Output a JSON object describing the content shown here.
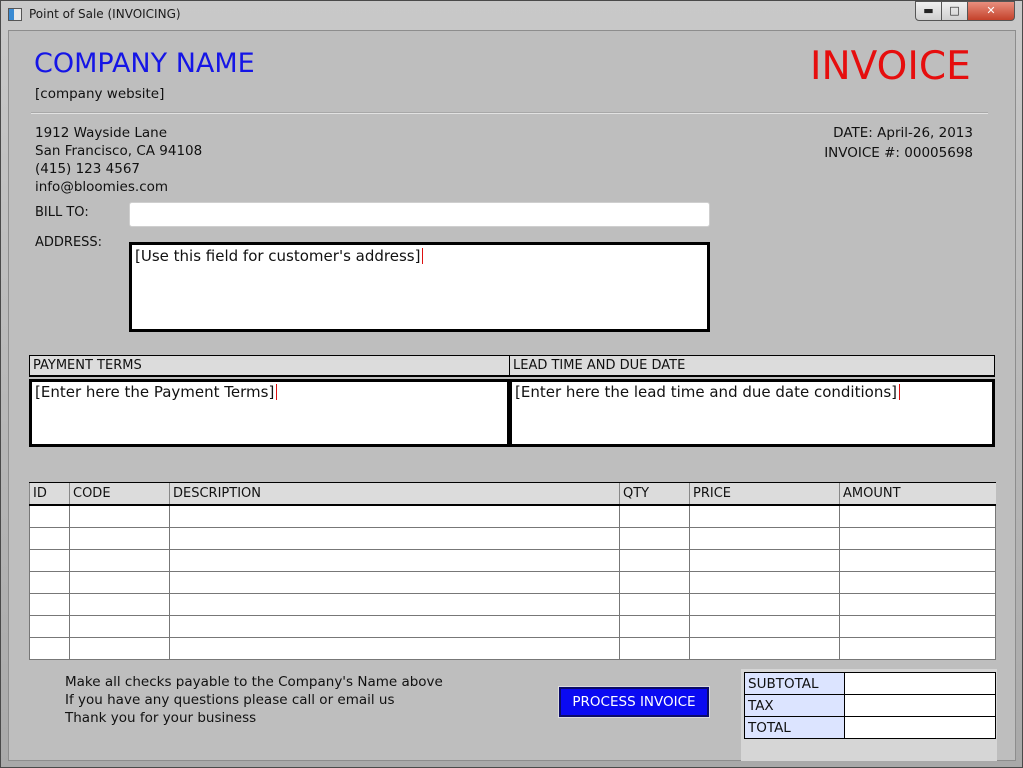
{
  "window": {
    "title": "Point of Sale (INVOICING)",
    "minimize": "▬",
    "maximize": "□",
    "close": "✕"
  },
  "header": {
    "company_name": "COMPANY NAME",
    "website": "[company website]",
    "invoice_title": "INVOICE",
    "address_lines": [
      "1912 Wayside Lane",
      "San Francisco, CA 94108",
      "(415) 123 4567",
      "info@bloomies.com"
    ],
    "date_label": "DATE:",
    "date_value": "April-26, 2013",
    "invoice_no_label": "INVOICE #:",
    "invoice_no_value": "00005698"
  },
  "billing": {
    "bill_to_label": "BILL TO:",
    "bill_to_value": "",
    "address_label": "ADDRESS:",
    "address_value": "[Use this field for customer's address]"
  },
  "terms": {
    "payment_terms_header": "PAYMENT TERMS",
    "payment_terms_value": "[Enter here the Payment Terms]",
    "lead_time_header": "LEAD TIME AND DUE DATE",
    "lead_time_value": "[Enter here the lead time and due date conditions]"
  },
  "items": {
    "columns": [
      "ID",
      "CODE",
      "DESCRIPTION",
      "QTY",
      "PRICE",
      "AMOUNT"
    ],
    "rows": [
      [
        "",
        "",
        "",
        "",
        "",
        ""
      ],
      [
        "",
        "",
        "",
        "",
        "",
        ""
      ],
      [
        "",
        "",
        "",
        "",
        "",
        ""
      ],
      [
        "",
        "",
        "",
        "",
        "",
        ""
      ],
      [
        "",
        "",
        "",
        "",
        "",
        ""
      ],
      [
        "",
        "",
        "",
        "",
        "",
        ""
      ],
      [
        "",
        "",
        "",
        "",
        "",
        ""
      ]
    ]
  },
  "footer": {
    "notes": [
      "Make all checks payable to the Company's Name above",
      "If you have any questions please call or email us",
      "Thank you for your business"
    ],
    "process_button": "PROCESS INVOICE",
    "subtotal_label": "SUBTOTAL",
    "subtotal_value": "",
    "tax_label": "TAX",
    "tax_value": "",
    "total_label": "TOTAL",
    "total_value": ""
  },
  "colors": {
    "company_name": "#1515e6",
    "invoice_title": "#e60e0e",
    "process_button": "#0a0af2",
    "totals_label_bg": "#dce4ff"
  }
}
